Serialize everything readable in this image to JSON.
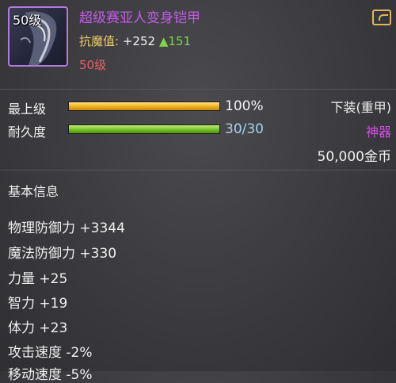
{
  "item": {
    "level_badge": "50级",
    "name": "超级赛亚人变身铠甲",
    "resist_label": "抗魔值:",
    "resist_value": "+252",
    "resist_bonus": "▲151",
    "required_level": "50级",
    "icon": "armor-portrait-icon"
  },
  "bars": {
    "upgrade_label": "最上级",
    "upgrade_value": "100%",
    "upgrade_fraction": 1.0,
    "durability_label": "耐久度",
    "durability_value": "30/30",
    "durability_fraction": 1.0
  },
  "meta": {
    "slot": "下装(重甲)",
    "grade": "神器",
    "price": "50,000金币"
  },
  "section": {
    "title": "基本信息"
  },
  "attributes": [
    "物理防御力 +3344",
    "魔法防御力 +330",
    "力量 +25",
    "智力 +19",
    "体力 +23",
    "攻击速度 -2%",
    "移动速度 -5%"
  ],
  "colors": {
    "name": "#c25ae6",
    "grade": "#d64be8",
    "required_level": "#ef5d63",
    "resist_label": "#f0c86c",
    "bonus": "#7fd448",
    "bar_gold": "#f2b520",
    "bar_green": "#7cc62a"
  }
}
